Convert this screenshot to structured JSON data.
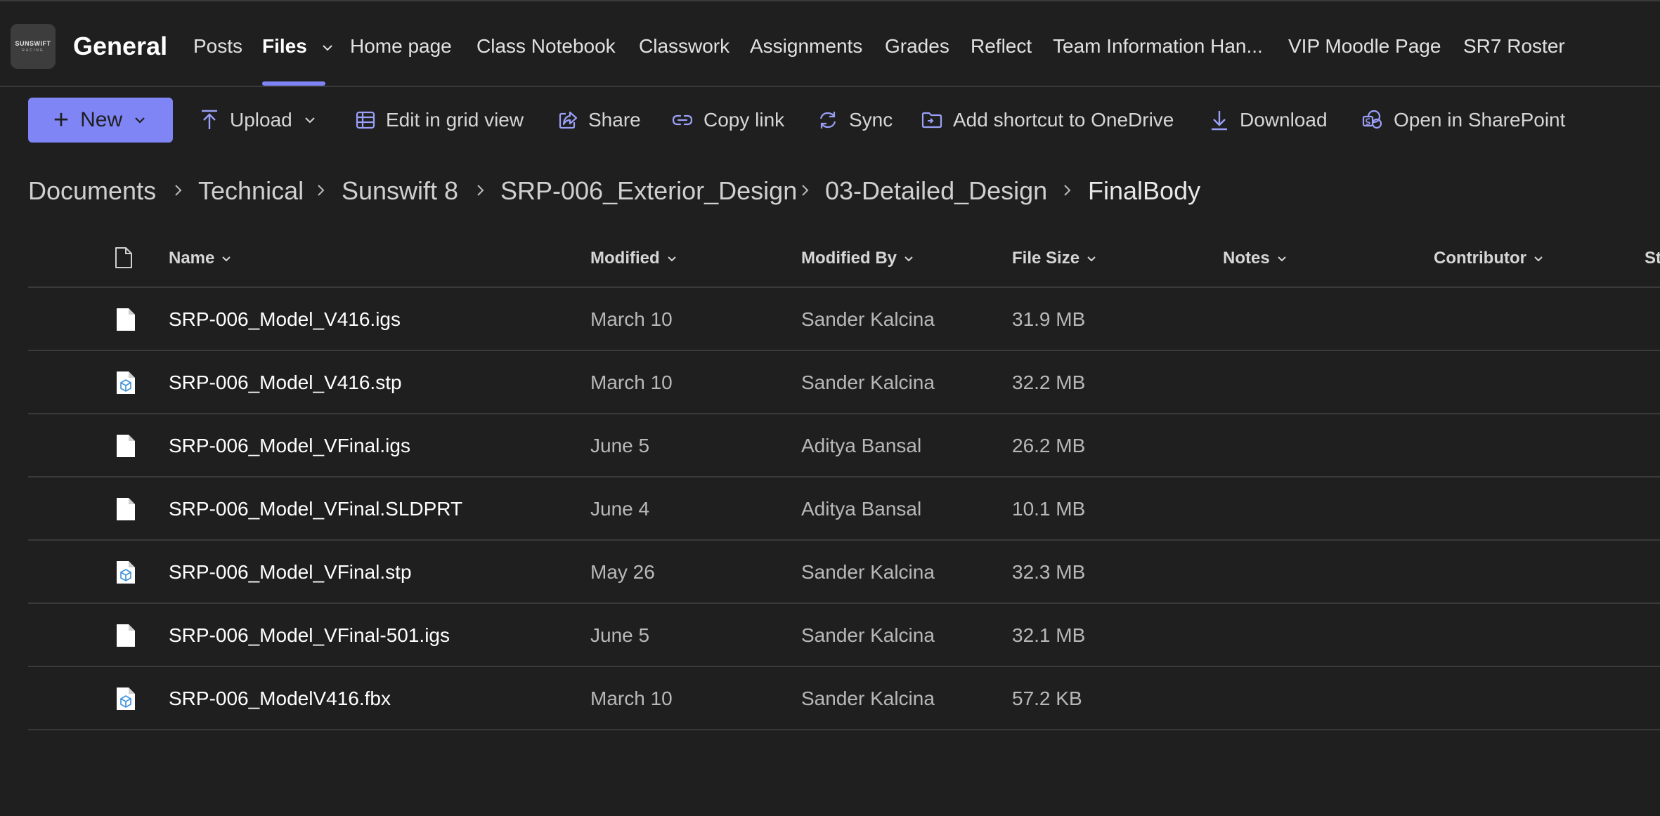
{
  "header": {
    "logo_text": "SUNSWIFT",
    "logo_subtext": "RACING",
    "channel_title": "General",
    "tabs": [
      {
        "label": "Posts"
      },
      {
        "label": "Files"
      },
      {
        "label": "Home page"
      },
      {
        "label": "Class Notebook"
      },
      {
        "label": "Classwork"
      },
      {
        "label": "Assignments"
      },
      {
        "label": "Grades"
      },
      {
        "label": "Reflect"
      },
      {
        "label": "Team Information Han..."
      },
      {
        "label": "VIP Moodle Page"
      },
      {
        "label": "SR7 Roster"
      }
    ],
    "active_tab": "Files"
  },
  "toolbar": {
    "new_label": "New",
    "upload_label": "Upload",
    "grid_label": "Edit in grid view",
    "share_label": "Share",
    "copy_link_label": "Copy link",
    "sync_label": "Sync",
    "shortcut_label": "Add shortcut to OneDrive",
    "download_label": "Download",
    "sharepoint_label": "Open in SharePoint"
  },
  "breadcrumb": [
    "Documents",
    "Technical",
    "Sunswift 8",
    "SRP-006_Exterior_Design",
    "03-Detailed_Design",
    "FinalBody"
  ],
  "table": {
    "columns": [
      "Name",
      "Modified",
      "Modified By",
      "File Size",
      "Notes",
      "Contributor",
      "St"
    ],
    "rows": [
      {
        "name": "SRP-006_Model_V416.igs",
        "modified": "March 10",
        "modified_by": "Sander Kalcina",
        "size": "31.9 MB",
        "icon": "generic-file-icon"
      },
      {
        "name": "SRP-006_Model_V416.stp",
        "modified": "March 10",
        "modified_by": "Sander Kalcina",
        "size": "32.2 MB",
        "icon": "3d-model-file-icon"
      },
      {
        "name": "SRP-006_Model_VFinal.igs",
        "modified": "June 5",
        "modified_by": "Aditya Bansal",
        "size": "26.2 MB",
        "icon": "generic-file-icon"
      },
      {
        "name": "SRP-006_Model_VFinal.SLDPRT",
        "modified": "June 4",
        "modified_by": "Aditya Bansal",
        "size": "10.1 MB",
        "icon": "generic-file-icon"
      },
      {
        "name": "SRP-006_Model_VFinal.stp",
        "modified": "May 26",
        "modified_by": "Sander Kalcina",
        "size": "32.3 MB",
        "icon": "3d-model-file-icon"
      },
      {
        "name": "SRP-006_Model_VFinal-501.igs",
        "modified": "June 5",
        "modified_by": "Sander Kalcina",
        "size": "32.1 MB",
        "icon": "generic-file-icon"
      },
      {
        "name": "SRP-006_ModelV416.fbx",
        "modified": "March 10",
        "modified_by": "Sander Kalcina",
        "size": "57.2 KB",
        "icon": "3d-model-file-icon"
      }
    ]
  },
  "colors": {
    "background": "#1f1f1f",
    "accent": "#7f85f5",
    "divider": "#3a3a3a",
    "secondary_text": "#b8b8b8"
  }
}
